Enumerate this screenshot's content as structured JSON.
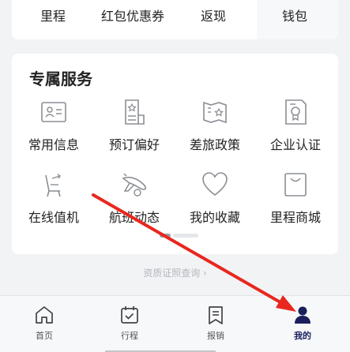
{
  "top_row": {
    "items": [
      {
        "label": "里程"
      },
      {
        "label": "红包优惠券"
      },
      {
        "label": "返现"
      },
      {
        "label": "钱包"
      }
    ]
  },
  "services": {
    "title": "专属服务",
    "items": [
      {
        "label": "常用信息",
        "icon": "id-card-icon"
      },
      {
        "label": "预订偏好",
        "icon": "preference-doc-icon"
      },
      {
        "label": "差旅政策",
        "icon": "policy-map-icon"
      },
      {
        "label": "企业认证",
        "icon": "certificate-icon"
      },
      {
        "label": "在线值机",
        "icon": "seat-checkin-icon"
      },
      {
        "label": "航班动态",
        "icon": "plane-icon"
      },
      {
        "label": "我的收藏",
        "icon": "heart-icon"
      },
      {
        "label": "里程商城",
        "icon": "shopping-bag-icon"
      }
    ],
    "page_indicator": {
      "pages": 2,
      "active": 0
    }
  },
  "qualification_link": "资质证照查询 ›",
  "tabbar": {
    "tabs": [
      {
        "label": "首页",
        "icon": "home-icon",
        "active": false
      },
      {
        "label": "行程",
        "icon": "calendar-icon",
        "active": false
      },
      {
        "label": "报销",
        "icon": "bookmark-doc-icon",
        "active": false
      },
      {
        "label": "我的",
        "icon": "user-icon",
        "active": true
      }
    ]
  },
  "colors": {
    "accent": "#1a1f5c",
    "annotation_arrow": "#e8281e",
    "icon_stroke": "#8a8d93"
  }
}
